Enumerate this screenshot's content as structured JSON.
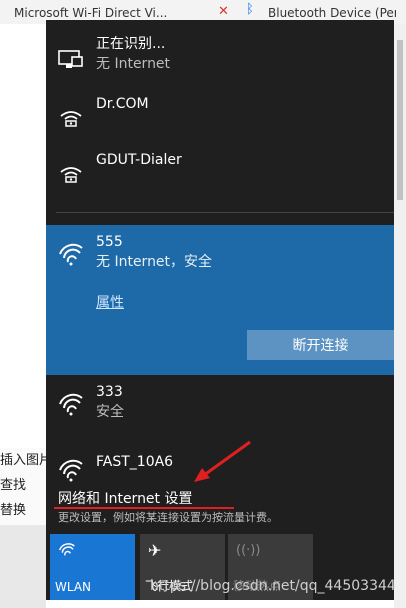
{
  "background": {
    "top_left_item": "Microsoft Wi-Fi Direct Vi...",
    "top_right_item": "Bluetooth Device (Perso",
    "left_menu": [
      "插入图片",
      "查找",
      "替换"
    ]
  },
  "networks": [
    {
      "name": "正在识别...",
      "status": "无 Internet",
      "icon": "ethernet-icon"
    },
    {
      "name": "Dr.COM",
      "status": "",
      "icon": "dialup-icon"
    },
    {
      "name": "GDUT-Dialer",
      "status": "",
      "icon": "dialup-icon"
    }
  ],
  "active_network": {
    "name": "555",
    "status": "无 Internet，安全",
    "properties_label": "属性",
    "disconnect_label": "断开连接"
  },
  "more_networks": [
    {
      "name": "333",
      "status": "安全"
    },
    {
      "name": "FAST_10A6",
      "status": ""
    }
  ],
  "settings": {
    "link_label": "网络和 Internet 设置",
    "description": "更改设置，例如将某连接设置为按流量计费。"
  },
  "tiles": [
    {
      "label": "WLAN",
      "state": "on"
    },
    {
      "label": "飞行模式",
      "state": "off"
    },
    {
      "label": "移动热点",
      "state": "disabled"
    }
  ],
  "watermark": "https://blog.csdn.net/qq_44503344",
  "colors": {
    "active_bg": "#1e6aa8",
    "tile_on": "#1976d2",
    "annotation": "#e02020"
  }
}
